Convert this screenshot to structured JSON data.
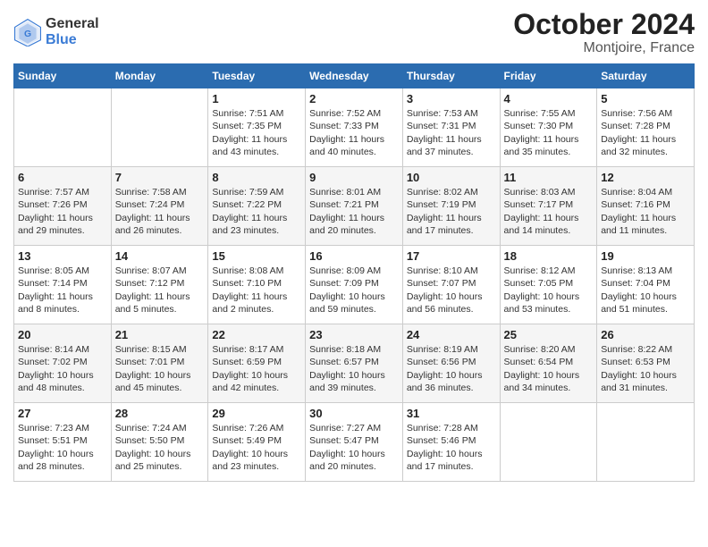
{
  "logo": {
    "general": "General",
    "blue": "Blue"
  },
  "header": {
    "month": "October 2024",
    "location": "Montjoire, France"
  },
  "weekdays": [
    "Sunday",
    "Monday",
    "Tuesday",
    "Wednesday",
    "Thursday",
    "Friday",
    "Saturday"
  ],
  "weeks": [
    [
      {
        "day": "",
        "info": ""
      },
      {
        "day": "",
        "info": ""
      },
      {
        "day": "1",
        "info": "Sunrise: 7:51 AM\nSunset: 7:35 PM\nDaylight: 11 hours\nand 43 minutes."
      },
      {
        "day": "2",
        "info": "Sunrise: 7:52 AM\nSunset: 7:33 PM\nDaylight: 11 hours\nand 40 minutes."
      },
      {
        "day": "3",
        "info": "Sunrise: 7:53 AM\nSunset: 7:31 PM\nDaylight: 11 hours\nand 37 minutes."
      },
      {
        "day": "4",
        "info": "Sunrise: 7:55 AM\nSunset: 7:30 PM\nDaylight: 11 hours\nand 35 minutes."
      },
      {
        "day": "5",
        "info": "Sunrise: 7:56 AM\nSunset: 7:28 PM\nDaylight: 11 hours\nand 32 minutes."
      }
    ],
    [
      {
        "day": "6",
        "info": "Sunrise: 7:57 AM\nSunset: 7:26 PM\nDaylight: 11 hours\nand 29 minutes."
      },
      {
        "day": "7",
        "info": "Sunrise: 7:58 AM\nSunset: 7:24 PM\nDaylight: 11 hours\nand 26 minutes."
      },
      {
        "day": "8",
        "info": "Sunrise: 7:59 AM\nSunset: 7:22 PM\nDaylight: 11 hours\nand 23 minutes."
      },
      {
        "day": "9",
        "info": "Sunrise: 8:01 AM\nSunset: 7:21 PM\nDaylight: 11 hours\nand 20 minutes."
      },
      {
        "day": "10",
        "info": "Sunrise: 8:02 AM\nSunset: 7:19 PM\nDaylight: 11 hours\nand 17 minutes."
      },
      {
        "day": "11",
        "info": "Sunrise: 8:03 AM\nSunset: 7:17 PM\nDaylight: 11 hours\nand 14 minutes."
      },
      {
        "day": "12",
        "info": "Sunrise: 8:04 AM\nSunset: 7:16 PM\nDaylight: 11 hours\nand 11 minutes."
      }
    ],
    [
      {
        "day": "13",
        "info": "Sunrise: 8:05 AM\nSunset: 7:14 PM\nDaylight: 11 hours\nand 8 minutes."
      },
      {
        "day": "14",
        "info": "Sunrise: 8:07 AM\nSunset: 7:12 PM\nDaylight: 11 hours\nand 5 minutes."
      },
      {
        "day": "15",
        "info": "Sunrise: 8:08 AM\nSunset: 7:10 PM\nDaylight: 11 hours\nand 2 minutes."
      },
      {
        "day": "16",
        "info": "Sunrise: 8:09 AM\nSunset: 7:09 PM\nDaylight: 10 hours\nand 59 minutes."
      },
      {
        "day": "17",
        "info": "Sunrise: 8:10 AM\nSunset: 7:07 PM\nDaylight: 10 hours\nand 56 minutes."
      },
      {
        "day": "18",
        "info": "Sunrise: 8:12 AM\nSunset: 7:05 PM\nDaylight: 10 hours\nand 53 minutes."
      },
      {
        "day": "19",
        "info": "Sunrise: 8:13 AM\nSunset: 7:04 PM\nDaylight: 10 hours\nand 51 minutes."
      }
    ],
    [
      {
        "day": "20",
        "info": "Sunrise: 8:14 AM\nSunset: 7:02 PM\nDaylight: 10 hours\nand 48 minutes."
      },
      {
        "day": "21",
        "info": "Sunrise: 8:15 AM\nSunset: 7:01 PM\nDaylight: 10 hours\nand 45 minutes."
      },
      {
        "day": "22",
        "info": "Sunrise: 8:17 AM\nSunset: 6:59 PM\nDaylight: 10 hours\nand 42 minutes."
      },
      {
        "day": "23",
        "info": "Sunrise: 8:18 AM\nSunset: 6:57 PM\nDaylight: 10 hours\nand 39 minutes."
      },
      {
        "day": "24",
        "info": "Sunrise: 8:19 AM\nSunset: 6:56 PM\nDaylight: 10 hours\nand 36 minutes."
      },
      {
        "day": "25",
        "info": "Sunrise: 8:20 AM\nSunset: 6:54 PM\nDaylight: 10 hours\nand 34 minutes."
      },
      {
        "day": "26",
        "info": "Sunrise: 8:22 AM\nSunset: 6:53 PM\nDaylight: 10 hours\nand 31 minutes."
      }
    ],
    [
      {
        "day": "27",
        "info": "Sunrise: 7:23 AM\nSunset: 5:51 PM\nDaylight: 10 hours\nand 28 minutes."
      },
      {
        "day": "28",
        "info": "Sunrise: 7:24 AM\nSunset: 5:50 PM\nDaylight: 10 hours\nand 25 minutes."
      },
      {
        "day": "29",
        "info": "Sunrise: 7:26 AM\nSunset: 5:49 PM\nDaylight: 10 hours\nand 23 minutes."
      },
      {
        "day": "30",
        "info": "Sunrise: 7:27 AM\nSunset: 5:47 PM\nDaylight: 10 hours\nand 20 minutes."
      },
      {
        "day": "31",
        "info": "Sunrise: 7:28 AM\nSunset: 5:46 PM\nDaylight: 10 hours\nand 17 minutes."
      },
      {
        "day": "",
        "info": ""
      },
      {
        "day": "",
        "info": ""
      }
    ]
  ]
}
